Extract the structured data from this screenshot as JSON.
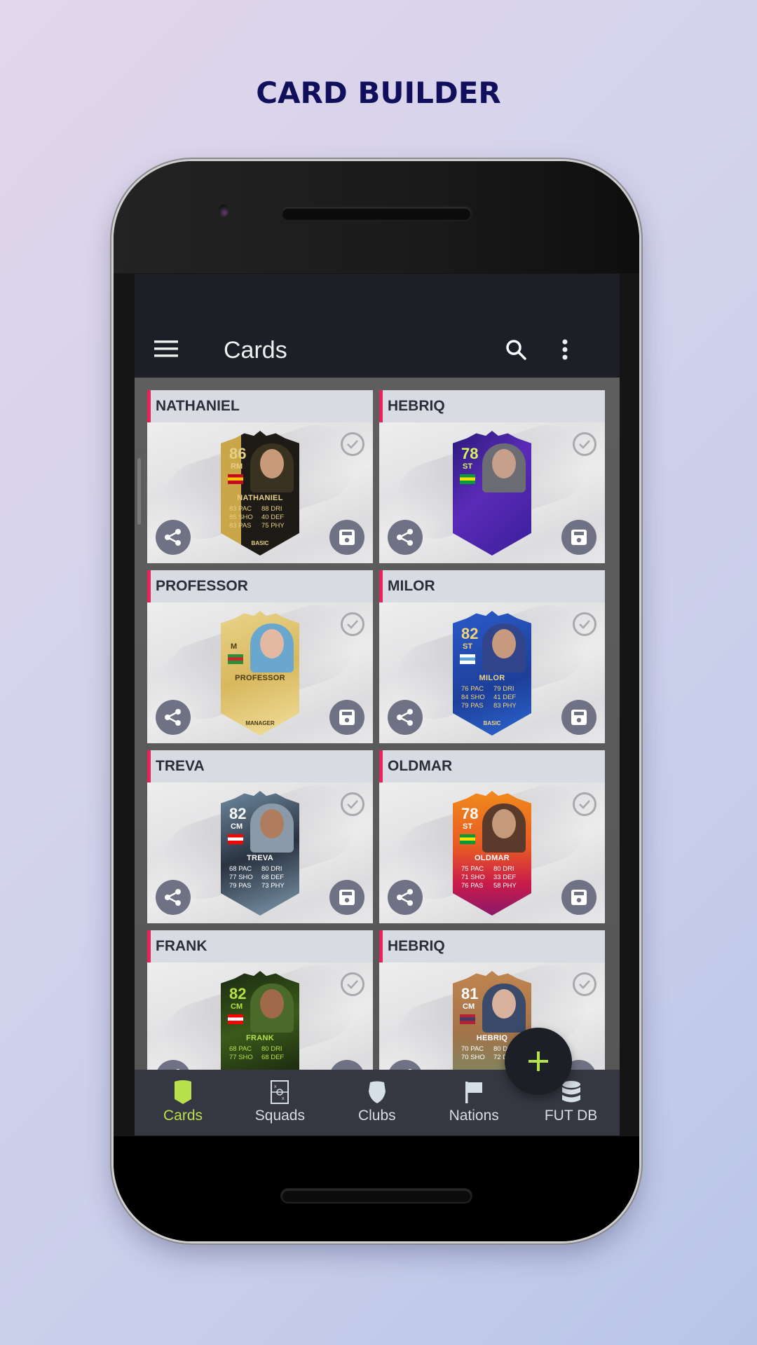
{
  "promo": {
    "title": "CARD BUILDER"
  },
  "app_bar": {
    "title": "Cards",
    "menu_icon": "hamburger-menu-icon",
    "search_icon": "search-icon",
    "more_icon": "more-vert-icon"
  },
  "colors": {
    "accent": "#b8e04a",
    "header_accent": "#e8235a",
    "app_bar_bg": "#1c1f26",
    "nav_bg": "#353842",
    "promo_title": "#0f0f5c"
  },
  "cards": [
    {
      "title": "NATHANIEL",
      "rating": "86",
      "position": "RM",
      "name": "NATHANIEL",
      "foot": "BASIC",
      "theme": "gold-black",
      "stats": [
        "83 PAC",
        "88 DRI",
        "85 SHO",
        "40 DEF",
        "83 PAS",
        "75 PHY"
      ]
    },
    {
      "title": "HEBRIQ",
      "rating": "78",
      "position": "ST",
      "name": "",
      "foot": "",
      "theme": "purple",
      "stats": []
    },
    {
      "title": "PROFESSOR",
      "rating": "",
      "position": "M",
      "name": "PROFESSOR",
      "foot": "MANAGER",
      "theme": "gold",
      "stats": []
    },
    {
      "title": "MILOR",
      "rating": "82",
      "position": "ST",
      "name": "MILOR",
      "foot": "BASIC",
      "theme": "blue",
      "stats": [
        "76 PAC",
        "79 DRI",
        "84 SHO",
        "41 DEF",
        "79 PAS",
        "83 PHY"
      ]
    },
    {
      "title": "TREVA",
      "rating": "82",
      "position": "CM",
      "name": "TREVA",
      "foot": "",
      "theme": "glitch",
      "stats": [
        "68 PAC",
        "80 DRI",
        "77 SHO",
        "68 DEF",
        "79 PAS",
        "73 PHY"
      ]
    },
    {
      "title": "OLDMAR",
      "rating": "78",
      "position": "ST",
      "name": "OLDMAR",
      "foot": "",
      "theme": "orange",
      "stats": [
        "75 PAC",
        "80 DRI",
        "71 SHO",
        "33 DEF",
        "76 PAS",
        "58 PHY"
      ]
    },
    {
      "title": "FRANK",
      "rating": "82",
      "position": "CM",
      "name": "FRANK",
      "foot": "",
      "theme": "green",
      "stats": [
        "68 PAC",
        "80 DRI",
        "77 SHO",
        "68 DEF"
      ]
    },
    {
      "title": "HEBRIQ",
      "rating": "81",
      "position": "CM",
      "name": "HEBRIQ",
      "foot": "",
      "theme": "bronze",
      "stats": [
        "70 PAC",
        "80 DRI",
        "70 SHO",
        "72 DEF"
      ]
    }
  ],
  "tile_actions": {
    "share_icon": "share-icon",
    "save_icon": "save-icon",
    "select_icon": "check-circle-icon"
  },
  "fab": {
    "icon": "plus-icon"
  },
  "bottom_nav": [
    {
      "label": "Cards",
      "icon": "card-icon",
      "active": true
    },
    {
      "label": "Squads",
      "icon": "pitch-icon",
      "active": false
    },
    {
      "label": "Clubs",
      "icon": "shield-icon",
      "active": false
    },
    {
      "label": "Nations",
      "icon": "flag-icon",
      "active": false
    },
    {
      "label": "FUT DB",
      "icon": "database-icon",
      "active": false
    }
  ]
}
